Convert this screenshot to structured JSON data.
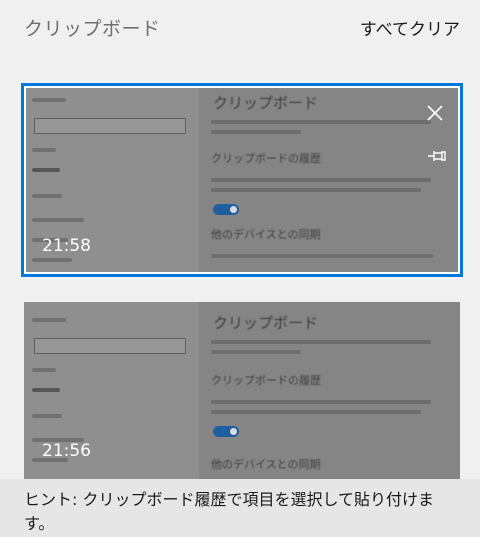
{
  "header": {
    "title": "クリップボード",
    "clear_all_label": "すべてクリア"
  },
  "items": [
    {
      "time": "21:58",
      "selected": true,
      "screenshot_title": "クリップボード",
      "screenshot_section1": "クリップボードの履歴",
      "screenshot_section2": "他のデバイスとの同期",
      "icons": [
        "close-icon",
        "pin-icon"
      ]
    },
    {
      "time": "21:56",
      "selected": false,
      "screenshot_title": "クリップボード",
      "screenshot_section1": "クリップボードの履歴",
      "screenshot_section2": "他のデバイスとの同期"
    }
  ],
  "footer": {
    "hint": "ヒント: クリップボード履歴で項目を選択して貼り付けます。"
  }
}
